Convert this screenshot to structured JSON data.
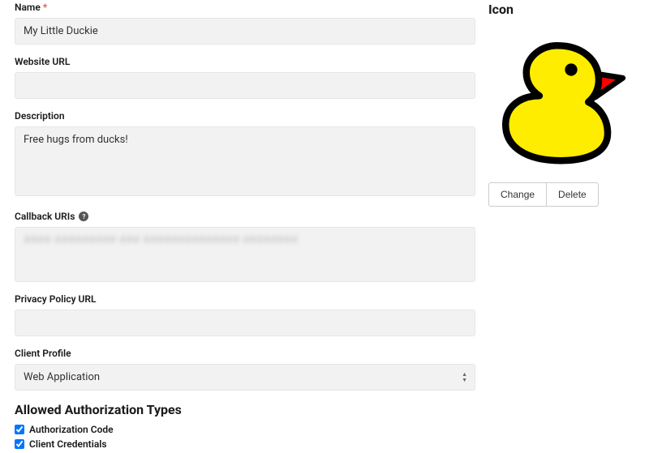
{
  "form": {
    "name": {
      "label": "Name",
      "required": true,
      "value": "My Little Duckie"
    },
    "website": {
      "label": "Website URL",
      "value": ""
    },
    "description": {
      "label": "Description",
      "value": "Free hugs from ducks!"
    },
    "callback": {
      "label": "Callback URIs",
      "info": true,
      "value_obscured": "#### ######### ### ############## ########"
    },
    "privacy": {
      "label": "Privacy Policy URL",
      "value": ""
    },
    "client_profile": {
      "label": "Client Profile",
      "selected": "Web Application"
    },
    "auth_types": {
      "heading": "Allowed Authorization Types",
      "options": [
        {
          "label": "Authorization Code",
          "checked": true
        },
        {
          "label": "Client Credentials",
          "checked": true
        }
      ]
    }
  },
  "side": {
    "heading": "Icon",
    "icon_name": "duck-icon",
    "buttons": {
      "change": "Change",
      "delete": "Delete"
    }
  }
}
